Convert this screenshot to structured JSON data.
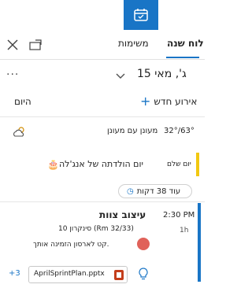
{
  "header": {
    "tabs": [
      {
        "label": "לוח שנה",
        "active": true
      },
      {
        "label": "משימות",
        "active": false
      }
    ]
  },
  "date_nav": {
    "title": "ג', מאי 15",
    "more": "···"
  },
  "actions": {
    "new_event": "אירוע חדש",
    "today": "היום"
  },
  "weather": {
    "temp": "32°/63°",
    "description": "מעונן עם מעונן"
  },
  "all_day": {
    "label": "יום שלם",
    "title": "יום הולדתה של אנג'לה"
  },
  "countdown": {
    "text": "עוד 38 דקות"
  },
  "event": {
    "time": "2:30 PM",
    "duration": "1h",
    "title": "עיצוב צוות",
    "location": "סינקרון 10 (Rm 32/33)",
    "note": "קט לארסון הזמינה אותך.",
    "attachment": "AprilSprintPlan.pptx",
    "more_attachments": "+3"
  },
  "colors": {
    "accent": "#1975c6",
    "all_day_bar": "#f2c811"
  }
}
